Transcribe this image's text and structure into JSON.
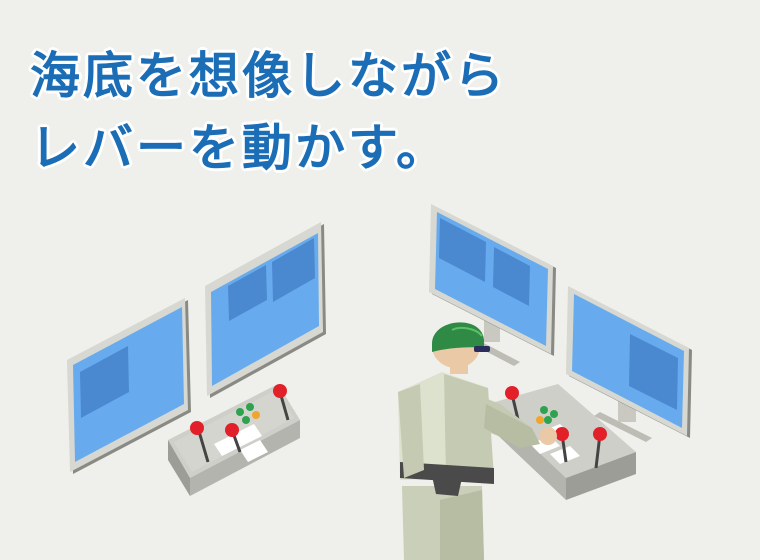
{
  "headline": {
    "line1": "海底を想像しながら",
    "line2": "レバーを動かす。"
  },
  "colors": {
    "background": "#efefeb",
    "headline_text": "#1b6db6",
    "screen_blue": "#67abee",
    "screen_panel": "#4a88cf",
    "button_red": "#e2202a",
    "button_green": "#2fa24f",
    "button_orange": "#f0a52c",
    "helmet_green": "#2f8a45"
  },
  "icons": [
    "monitor-icon",
    "control-console-icon",
    "joystick-icon",
    "operator-figure-icon"
  ]
}
